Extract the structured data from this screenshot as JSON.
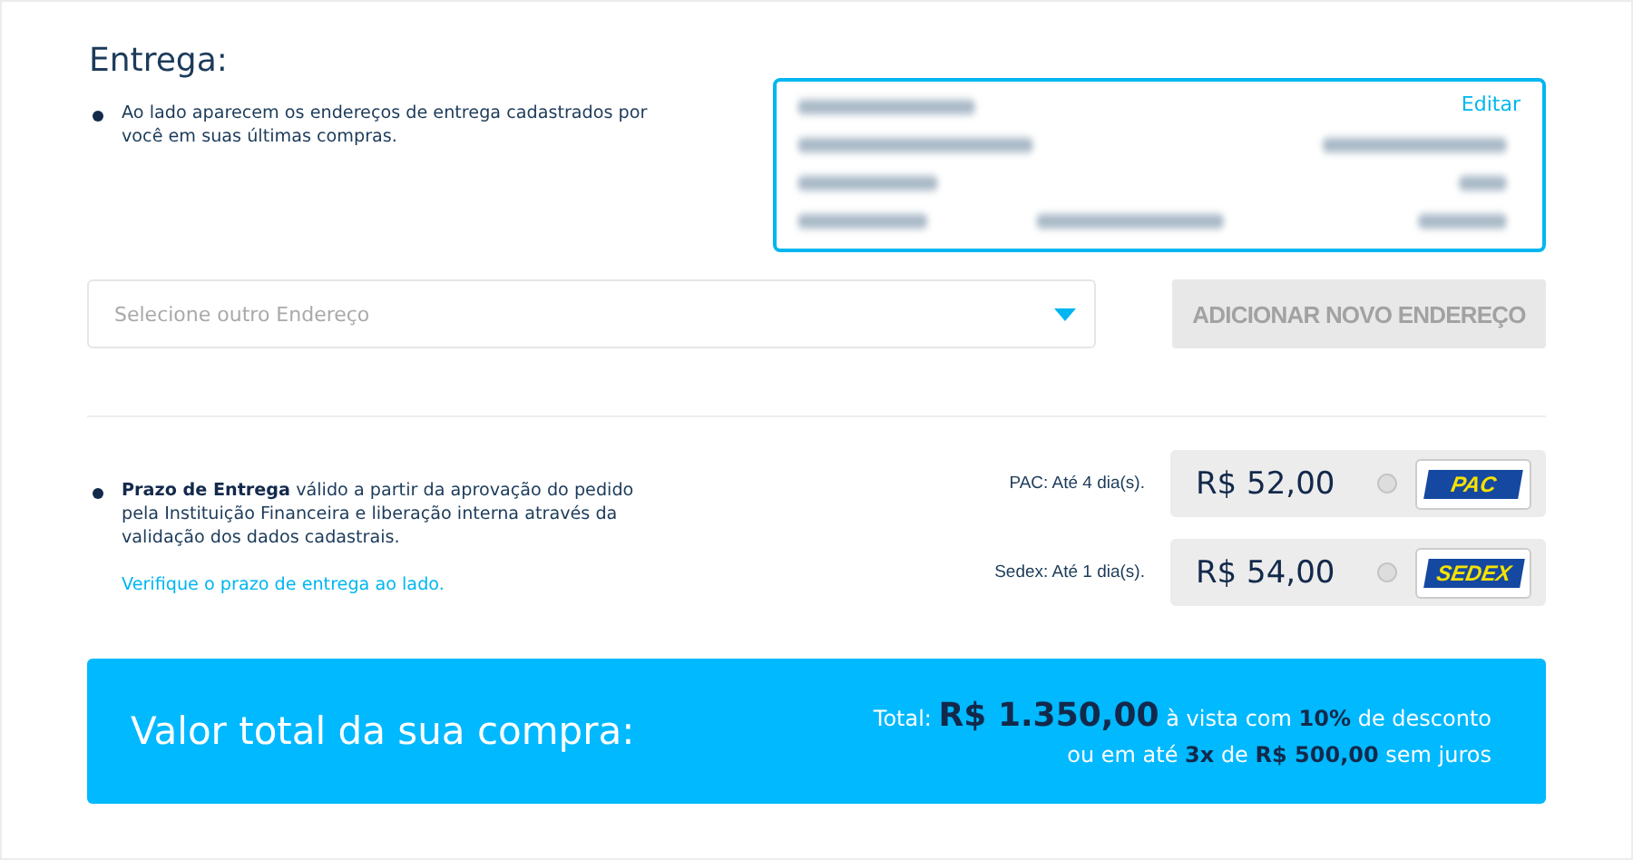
{
  "section_title": "Entrega:",
  "address_note": "Ao lado aparecem os endereços de entrega cadastrados por você em suas últimas compras.",
  "address_card": {
    "edit_link": "Editar"
  },
  "address_select": {
    "placeholder": "Selecione outro Endereço"
  },
  "add_address_button": "ADICIONAR NOVO ENDEREÇO",
  "delivery_note": "**Prazo de Entrega** válido a partir da aprovação do pedido pela Instituição Financeira e liberação interna através da validação dos dados cadastrais.",
  "delivery_link": "Verifique o prazo de entrega ao lado.",
  "shipping_options": [
    {
      "label": "PAC: Até 4 dia(s).",
      "price": "R$ 52,00",
      "selected": false,
      "logo": "PAC",
      "kind": "pac"
    },
    {
      "label": "Sedex: Até 1 dia(s).",
      "price": "R$ 54,00",
      "selected": false,
      "logo": "SEDEX",
      "kind": "sedex"
    }
  ],
  "total_bar": {
    "title": "Valor total da sua compra:",
    "line_1": "Total: **R$ 1.350,00** à vista com **10%** de desconto",
    "line_2": "ou em até **3x** de **R$ 500,00** sem juros"
  }
}
